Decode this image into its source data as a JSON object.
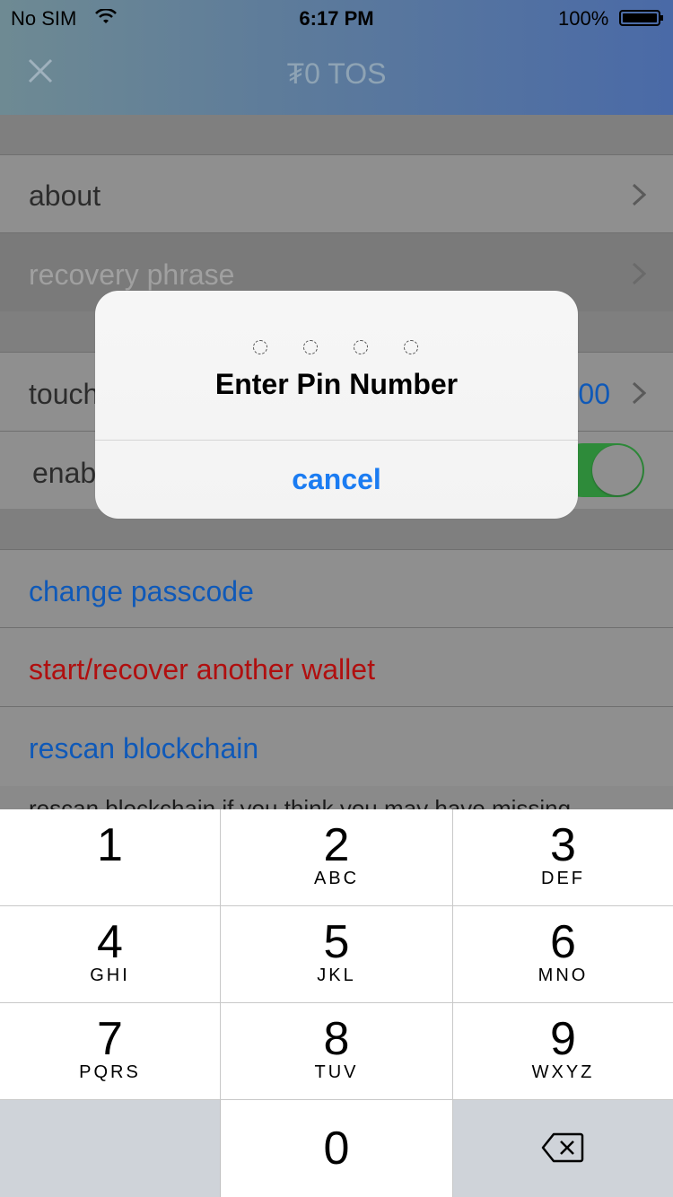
{
  "status": {
    "carrier": "No SIM",
    "time": "6:17 PM",
    "battery": "100%"
  },
  "nav": {
    "title": "₮0  TOS"
  },
  "list": {
    "about": "about",
    "recovery": "recovery phrase",
    "touch": "touch",
    "touch_value": "00",
    "enable": "enab",
    "change_passcode": "change passcode",
    "start_recover": "start/recover another wallet",
    "rescan": "rescan blockchain",
    "rescan_note": "rescan blockchain if you think you may have missing"
  },
  "dialog": {
    "title": "Enter Pin Number",
    "cancel": "cancel"
  },
  "keypad": {
    "k1": "1",
    "k2": "2",
    "k2l": "ABC",
    "k3": "3",
    "k3l": "DEF",
    "k4": "4",
    "k4l": "GHI",
    "k5": "5",
    "k5l": "JKL",
    "k6": "6",
    "k6l": "MNO",
    "k7": "7",
    "k7l": "PQRS",
    "k8": "8",
    "k8l": "TUV",
    "k9": "9",
    "k9l": "WXYZ",
    "k0": "0"
  },
  "colors": {
    "accent_blue": "#0f59b8",
    "danger_red": "#b00f0f",
    "toggle_green": "#2e8b3a"
  }
}
